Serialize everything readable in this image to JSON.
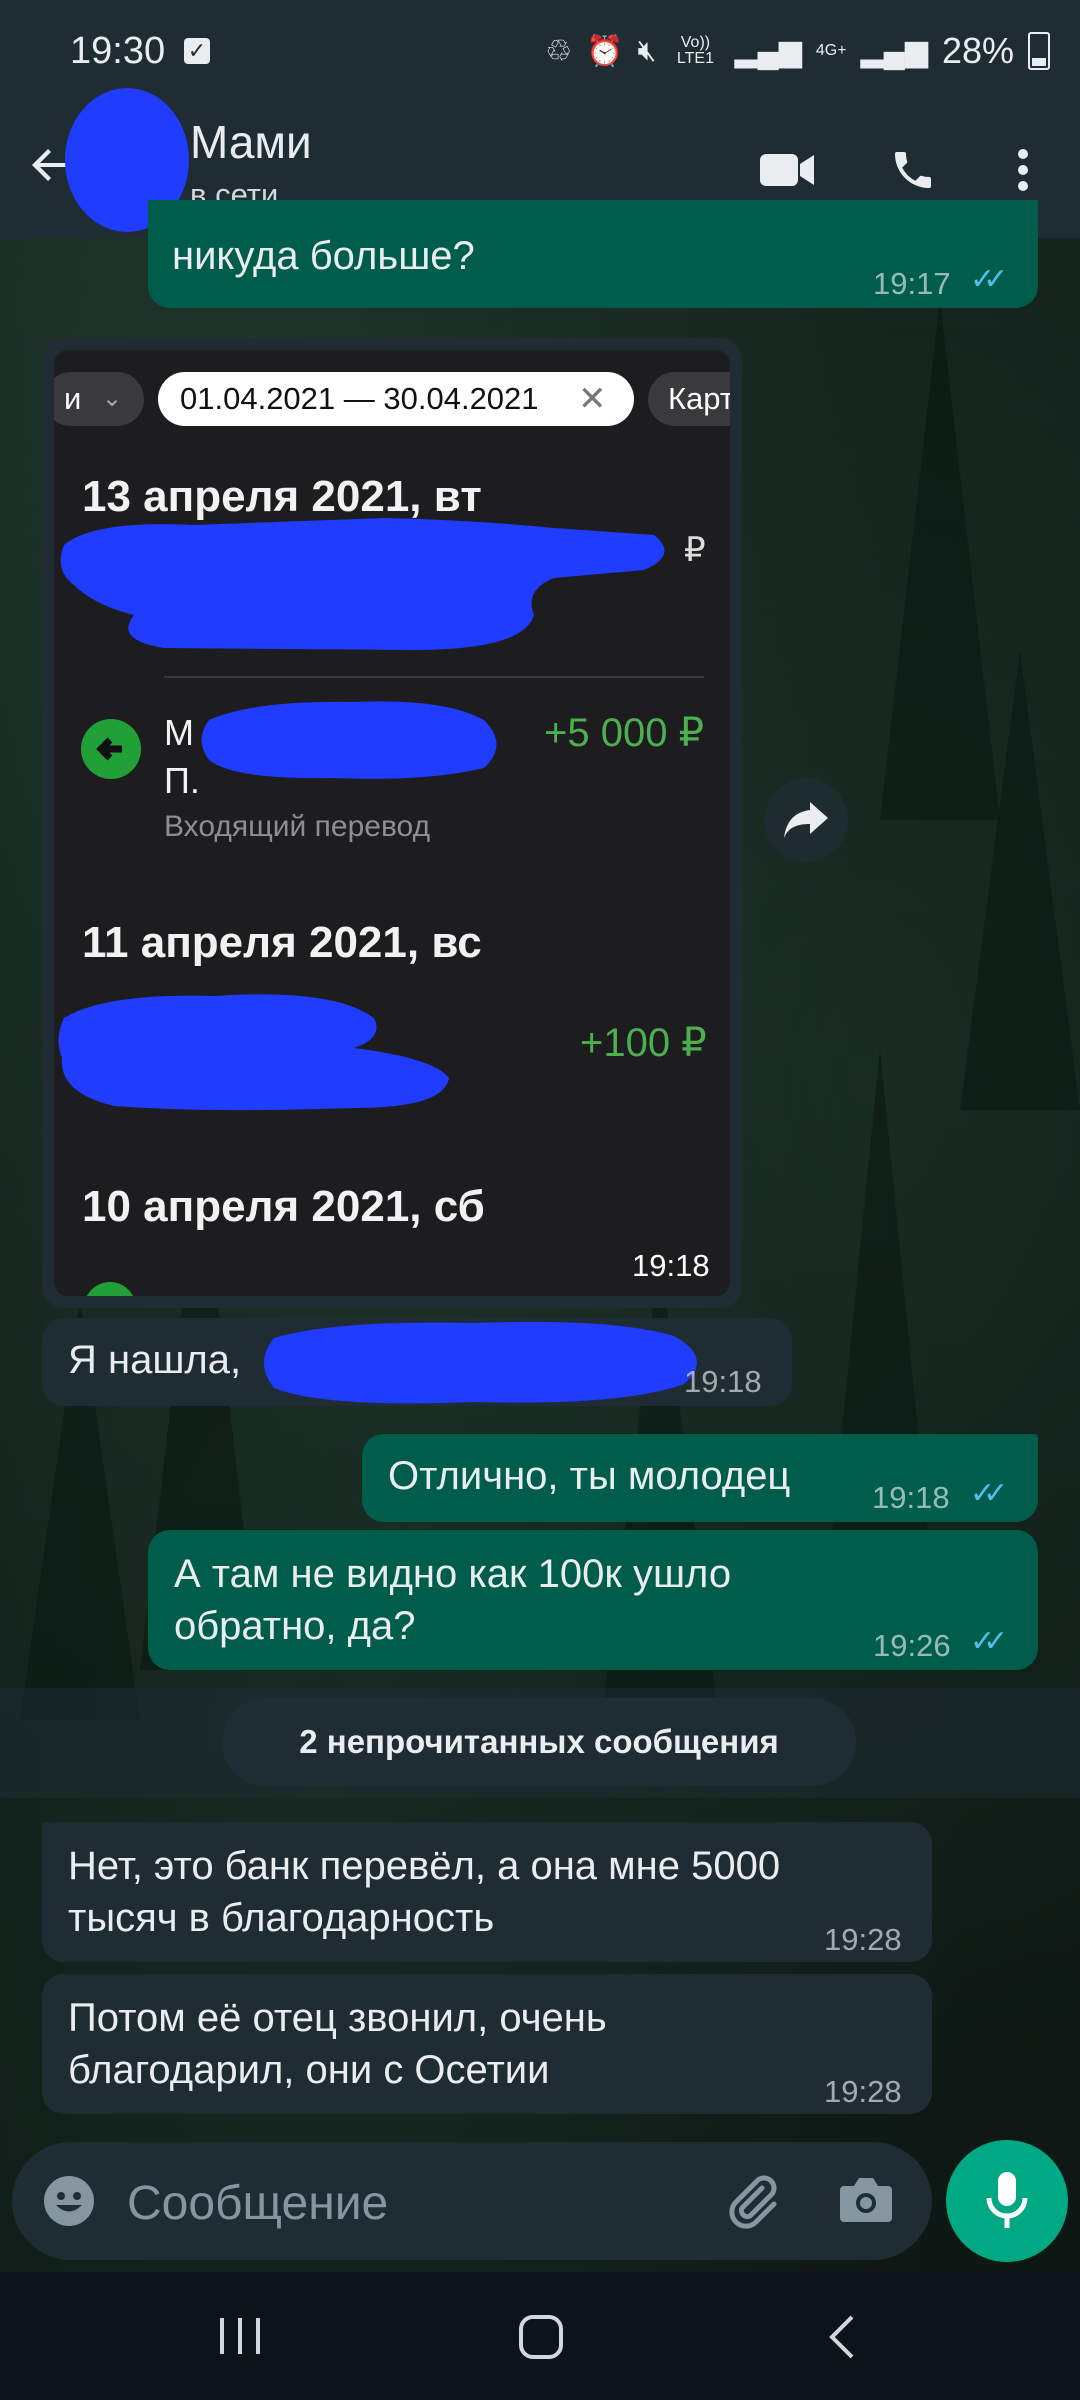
{
  "status_bar": {
    "time": "19:30",
    "network": "Vo)) LTE1",
    "net_type": "4G+",
    "battery": "28%"
  },
  "header": {
    "contact_name": "Мами",
    "contact_status": "в сети"
  },
  "messages": [
    {
      "id": "m1",
      "text": "никуда больше?",
      "time": "19:17"
    },
    {
      "id": "m2",
      "time": "19:18"
    },
    {
      "id": "m3",
      "text": "Я нашла,",
      "time": "19:18"
    },
    {
      "id": "m4",
      "text": "Отлично, ты молодец",
      "time": "19:18"
    },
    {
      "id": "m5",
      "line1": "А там не видно как 100к ушло",
      "line2": "обратно, да?",
      "time": "19:26"
    },
    {
      "id": "m6",
      "line1": "Нет, это банк перевёл, а она мне 5000",
      "line2": "тысяч в благодарность",
      "time": "19:28"
    },
    {
      "id": "m7",
      "line1": "Потом её отец звонил, очень",
      "line2": "благодарил, они с Осетии",
      "time": "19:28"
    }
  ],
  "screenshot": {
    "chip_left": "и",
    "date_range": "01.04.2021 — 30.04.2021",
    "chip_right": "Карт",
    "day1": "13 апреля 2021, вт",
    "day1_currency": "₽",
    "tx_name_letter": "М",
    "tx_name_second": "П.",
    "tx_desc": "Входящий перевод",
    "tx_amount": "+5 000 ₽",
    "day2": "11 апреля 2021, вс",
    "day2_amount": "+100 ₽",
    "day3": "10 апреля 2021, сб"
  },
  "unread_banner": "2 непрочитанных сообщения",
  "input": {
    "placeholder": "Сообщение"
  },
  "colors": {
    "outgoing": "#005c4b",
    "incoming": "#202c33",
    "accent": "#00a884",
    "read_ticks": "#53bdeb"
  }
}
